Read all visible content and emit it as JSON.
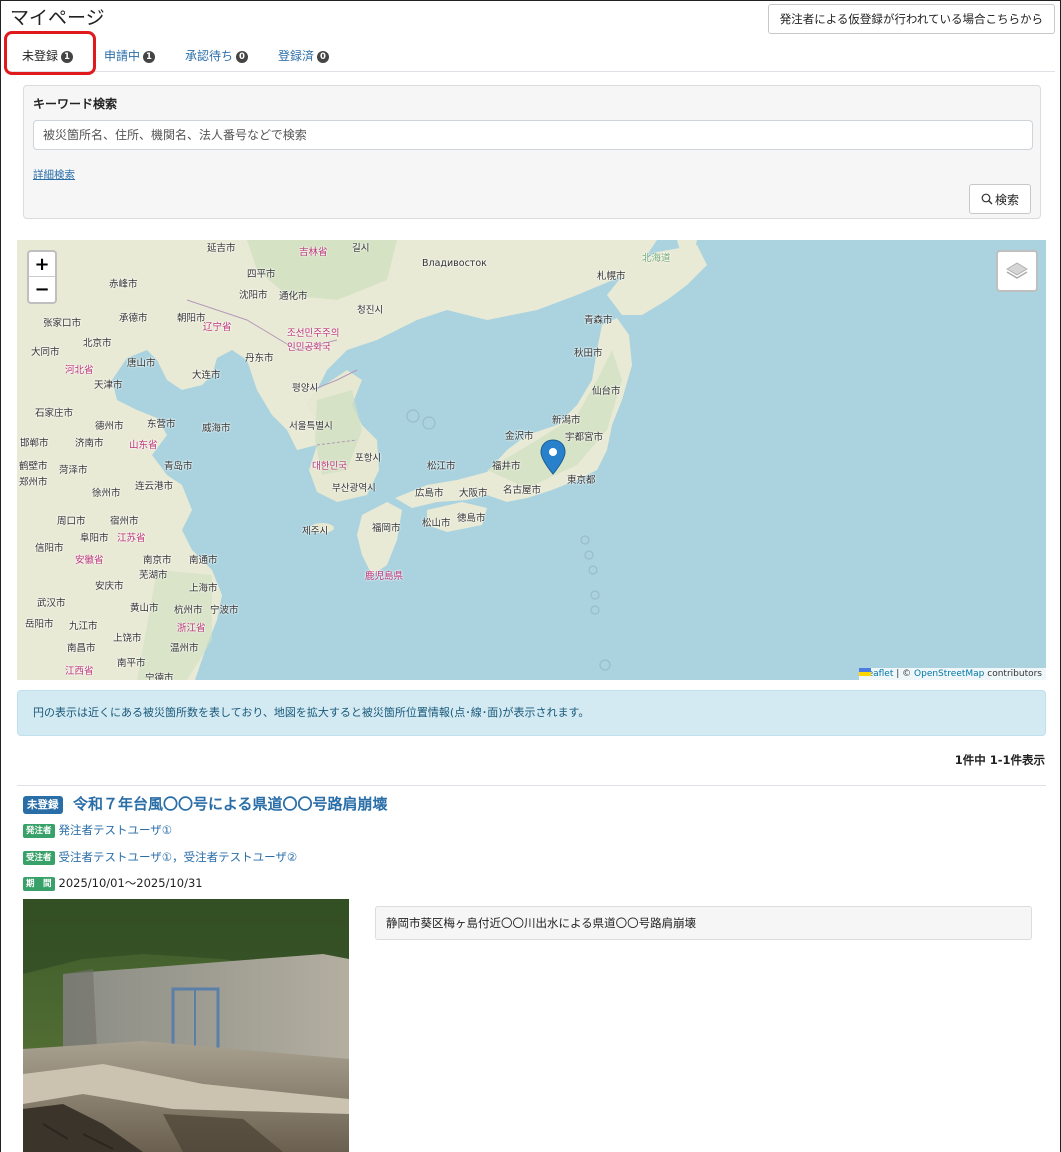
{
  "page": {
    "title": "マイページ"
  },
  "header": {
    "provisional_button": "発注者による仮登録が行われている場合こちらから"
  },
  "tabs": [
    {
      "label": "未登録",
      "count": "1",
      "active": true
    },
    {
      "label": "申請中",
      "count": "1",
      "active": false
    },
    {
      "label": "承認待ち",
      "count": "0",
      "active": false
    },
    {
      "label": "登録済",
      "count": "0",
      "active": false
    }
  ],
  "search": {
    "label": "キーワード検索",
    "placeholder": "被災箇所名、住所、機関名、法人番号などで検索",
    "advanced_link": "詳細検索",
    "button": "検索"
  },
  "map": {
    "zoom_in": "+",
    "zoom_out": "−",
    "attribution_leaflet": "Leaflet",
    "attribution_sep": " | © ",
    "attribution_osm": "OpenStreetMap",
    "attribution_tail": " contributors",
    "labels": [
      {
        "text": "Владивосток"
      },
      {
        "text": "札幌市"
      },
      {
        "text": "北海道"
      },
      {
        "text": "青森市"
      },
      {
        "text": "秋田市"
      },
      {
        "text": "仙台市"
      },
      {
        "text": "新潟市"
      },
      {
        "text": "金沢市"
      },
      {
        "text": "宇都宮市"
      },
      {
        "text": "福井市"
      },
      {
        "text": "東京都"
      },
      {
        "text": "松江市"
      },
      {
        "text": "広島市"
      },
      {
        "text": "大阪市"
      },
      {
        "text": "名古屋市"
      },
      {
        "text": "松山市"
      },
      {
        "text": "徳島市"
      },
      {
        "text": "福岡市"
      },
      {
        "text": "鹿児島県"
      },
      {
        "text": "부산광역시"
      },
      {
        "text": "대한민국"
      },
      {
        "text": "서울특별시"
      },
      {
        "text": "평양시"
      },
      {
        "text": "조선민주주의인민공화국"
      },
      {
        "text": "청진시"
      },
      {
        "text": "제주시"
      },
      {
        "text": "포항시"
      },
      {
        "text": "沈阳市"
      },
      {
        "text": "四平市"
      },
      {
        "text": "通化市"
      },
      {
        "text": "赤峰市"
      },
      {
        "text": "朝阳市"
      },
      {
        "text": "承德市"
      },
      {
        "text": "张家口市"
      },
      {
        "text": "北京市"
      },
      {
        "text": "大同市"
      },
      {
        "text": "天津市"
      },
      {
        "text": "唐山市"
      },
      {
        "text": "大连市"
      },
      {
        "text": "丹东市"
      },
      {
        "text": "石家庄市"
      },
      {
        "text": "德州市"
      },
      {
        "text": "东营市"
      },
      {
        "text": "威海市"
      },
      {
        "text": "济南市"
      },
      {
        "text": "邯郸市"
      },
      {
        "text": "菏泽市"
      },
      {
        "text": "青岛市"
      },
      {
        "text": "郑州市"
      },
      {
        "text": "连云港市"
      },
      {
        "text": "徐州市"
      },
      {
        "text": "周口市"
      },
      {
        "text": "宿州市"
      },
      {
        "text": "阜阳市"
      },
      {
        "text": "信阳市"
      },
      {
        "text": "南京市"
      },
      {
        "text": "南通市"
      },
      {
        "text": "芜湖市"
      },
      {
        "text": "上海市"
      },
      {
        "text": "安庆市"
      },
      {
        "text": "武汉市"
      },
      {
        "text": "黄山市"
      },
      {
        "text": "杭州市"
      },
      {
        "text": "宁波市"
      },
      {
        "text": "岳阳市"
      },
      {
        "text": "九江市"
      },
      {
        "text": "上饶市"
      },
      {
        "text": "温州市"
      },
      {
        "text": "南昌市"
      },
      {
        "text": "南平市"
      },
      {
        "text": "宁德市"
      },
      {
        "text": "鹤壁市"
      },
      {
        "text": "辽宁省"
      },
      {
        "text": "吉林省"
      },
      {
        "text": "山东省"
      },
      {
        "text": "江苏省"
      },
      {
        "text": "安徽省"
      },
      {
        "text": "浙江省"
      },
      {
        "text": "江西省"
      },
      {
        "text": "河北省"
      },
      {
        "text": "延吉市"
      },
      {
        "text": "길시"
      }
    ]
  },
  "info": {
    "message": "円の表示は近くにある被災箇所数を表しており、地図を拡大すると被災箇所位置情報(点･線･面)が表示されます。"
  },
  "results": {
    "count_text": "1件中 1-1件表示",
    "item": {
      "status": "未登録",
      "title": "令和７年台風〇〇号による県道〇〇号路肩崩壊",
      "orderer_badge": "発注者",
      "orderer": "発注者テストユーザ①",
      "contractor_badge": "受注者",
      "contractors": "受注者テストユーザ①，受注者テストユーザ②",
      "period_badge": "期　間",
      "period": "2025/10/01～2025/10/31",
      "description": "静岡市葵区梅ヶ島付近〇〇川出水による県道〇〇号路肩崩壊"
    }
  }
}
